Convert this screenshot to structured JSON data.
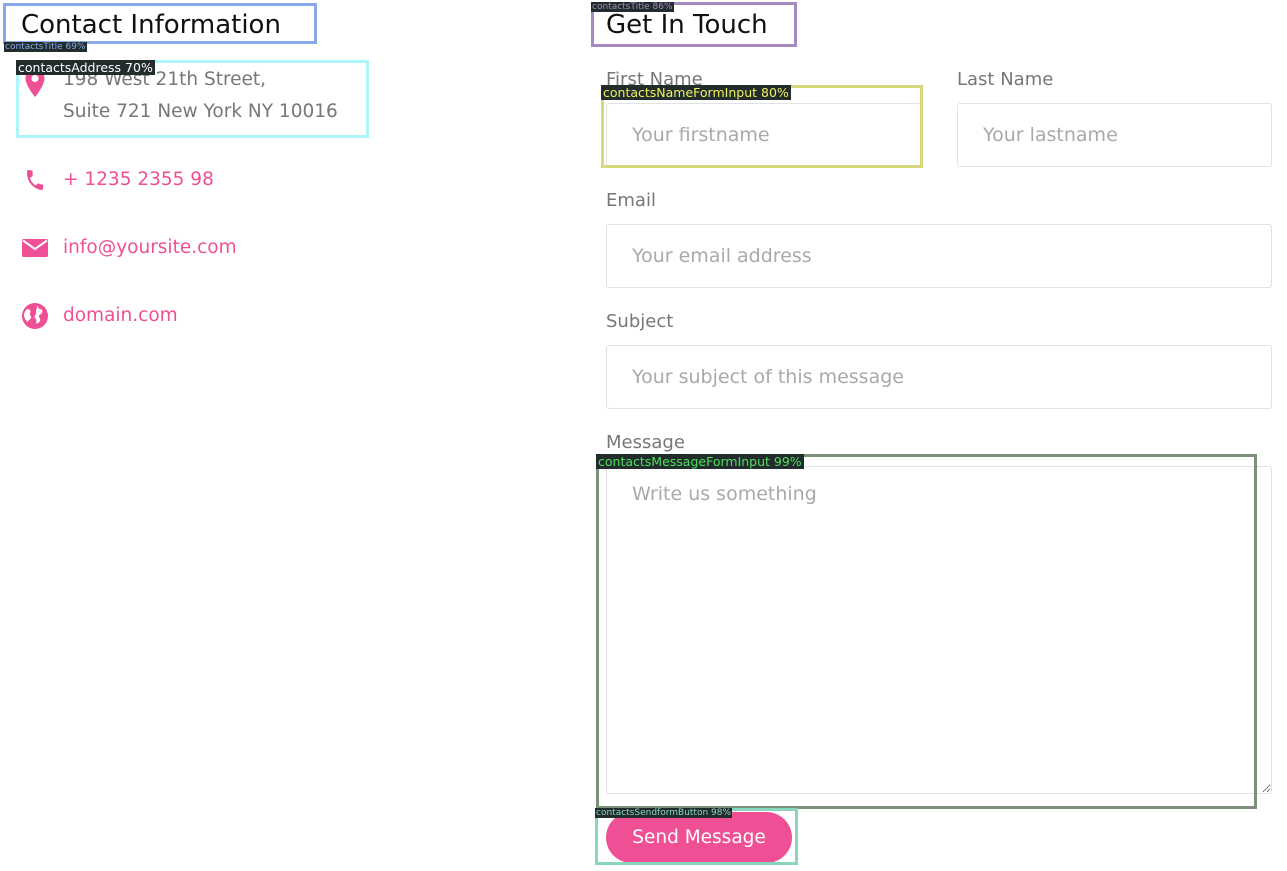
{
  "contact_info": {
    "title": "Contact Information",
    "address_line1": "198 West 21th Street,",
    "address_line2": "Suite 721 New York NY 10016",
    "phone": "+ 1235 2355 98",
    "email": "info@yoursite.com",
    "website": "domain.com",
    "icons": [
      "map-pin-icon",
      "phone-icon",
      "envelope-icon",
      "globe-icon"
    ]
  },
  "form": {
    "title": "Get In Touch",
    "first_name": {
      "label": "First Name",
      "placeholder": "Your firstname",
      "value": ""
    },
    "last_name": {
      "label": "Last Name",
      "placeholder": "Your lastname",
      "value": ""
    },
    "email": {
      "label": "Email",
      "placeholder": "Your email address",
      "value": ""
    },
    "subject": {
      "label": "Subject",
      "placeholder": "Your subject of this message",
      "value": ""
    },
    "message": {
      "label": "Message",
      "placeholder": "Write us something",
      "value": ""
    },
    "submit_label": "Send Message"
  },
  "detections": {
    "contacts_title_left": "contactsTitle 69%",
    "contacts_address": "contactsAddress 70%",
    "contacts_title_right": "contactsTitle 86%",
    "name_form_input": "contactsNameFormInput 80%",
    "message_form_input": "contactsMessageFormInput 99%",
    "sendform_button": "contactsSendformButton 98%"
  },
  "colors": {
    "accent": "#ef4f94",
    "box_contacts_title_left": "#89a9ea",
    "box_contacts_address": "#aef5f7",
    "box_contacts_title_right": "#a68ac0",
    "box_name_input": "#d8d97d",
    "box_message_input": "#7c9278",
    "box_send_button": "#87d6bd"
  }
}
